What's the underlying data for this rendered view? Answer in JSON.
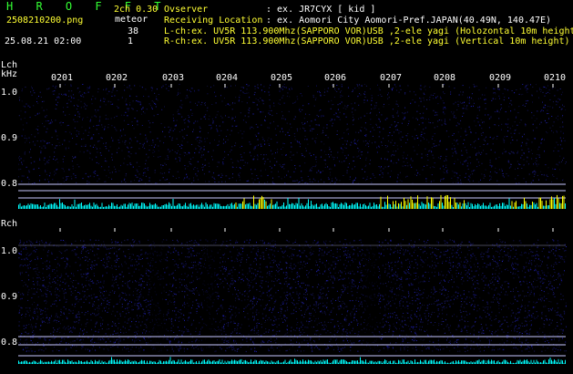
{
  "header": {
    "brand": "H R O F F T",
    "filename": "2508210200.png",
    "datetime": "25.08.21 02:00",
    "version": "2ch 0.30",
    "meteor_label": "meteor",
    "meteor_count_l": "38",
    "meteor_count_r": "1",
    "observer_label": "Ovserver",
    "observer_value": ": ex. JR7CYX [ kid ]",
    "location_label": "Receiving Location",
    "location_value": ": ex. Aomori City Aomori-Pref.JAPAN(40.49N, 140.47E)",
    "lch_info": "L-ch:ex. UV5R 113.900Mhz(SAPPORO VOR)USB ,2-ele yagi (Holozontal 10m height)",
    "rch_info": "R-ch:ex. UV5R 113.900Mhz(SAPPORO VOR)USB ,2-ele yagi (Vertical 10m height)"
  },
  "lch_panel": {
    "label": "Lch",
    "unit": "kHz",
    "ticks": [
      "1.0",
      "0.9",
      "0.8"
    ]
  },
  "rch_panel": {
    "label": "Rch",
    "ticks": [
      "1.0",
      "0.9",
      "0.8"
    ]
  },
  "time_labels": [
    "0201",
    "0202",
    "0203",
    "0204",
    "0205",
    "0206",
    "0207",
    "0208",
    "0209",
    "0210"
  ],
  "colors": {
    "background": "#000000",
    "noise": "#2a2ad0",
    "meteor_trace_l": "#00ffff",
    "meteor_peak": "#ffff00",
    "reference_line": "#c8c8ff"
  }
}
